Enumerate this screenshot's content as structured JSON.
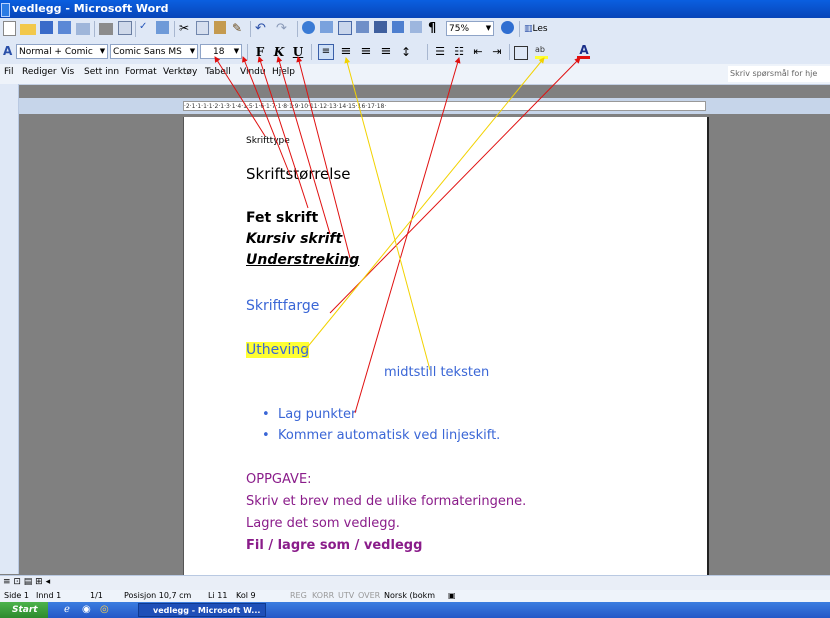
{
  "window": {
    "title": "vedlegg - Microsoft Word"
  },
  "toolbar_standard": {
    "zoom": "75%",
    "read_label": "Les"
  },
  "toolbar_format": {
    "style": "Normal + Comic",
    "font": "Comic Sans MS",
    "size": "18",
    "bold_label": "F",
    "italic_label": "K",
    "underline_label": "U",
    "highlight_label": "ab",
    "fontcolor_label": "A"
  },
  "menu": {
    "items": [
      "Fil",
      "Rediger",
      "Vis",
      "Sett inn",
      "Format",
      "Verktøy",
      "Tabell",
      "Vindu",
      "Hjelp"
    ]
  },
  "help_box": {
    "placeholder": "Skriv spørsmål for hje"
  },
  "ruler": {
    "text": "·2·1·1·1·1·2·1·3·1·4·1·5·1·6·1·7·1·8·1·9·10·11·12·13·14·15·16·17·18·"
  },
  "document": {
    "skrifttype": "Skrifttype",
    "skriftstorrelse": "Skriftstørrelse",
    "fet": "Fet skrift",
    "kursiv": "Kursiv skrift",
    "understreking": "Understreking",
    "skriftfarge": "Skriftfarge",
    "utheving": "Utheving",
    "midtstill": "midtstill teksten",
    "bullets": [
      "Lag punkter",
      "Kommer automatisk ved linjeskift."
    ],
    "oppgave": "OPPGAVE:",
    "line1": "Skriv et brev med de ulike formateringene.",
    "line2": "Lagre det som vedlegg.",
    "line3": "Fil / lagre som / vedlegg"
  },
  "colors": {
    "blue_text": "#3a66d6",
    "purple_text": "#8a1c8a",
    "highlight": "#ffff33",
    "red_arrow": "#e01010",
    "yellow_arrow": "#f2d200"
  },
  "status": {
    "side": "Side 1",
    "innd": "Innd 1",
    "pages": "1/1",
    "position": "Posisjon 10,7 cm",
    "line": "Li 11",
    "col": "Kol 9",
    "rec": "REG",
    "korr": "KORR",
    "utv": "UTV",
    "over": "OVER",
    "lang": "Norsk (bokm"
  },
  "taskbar": {
    "start": "Start",
    "task": "vedlegg - Microsoft W..."
  }
}
